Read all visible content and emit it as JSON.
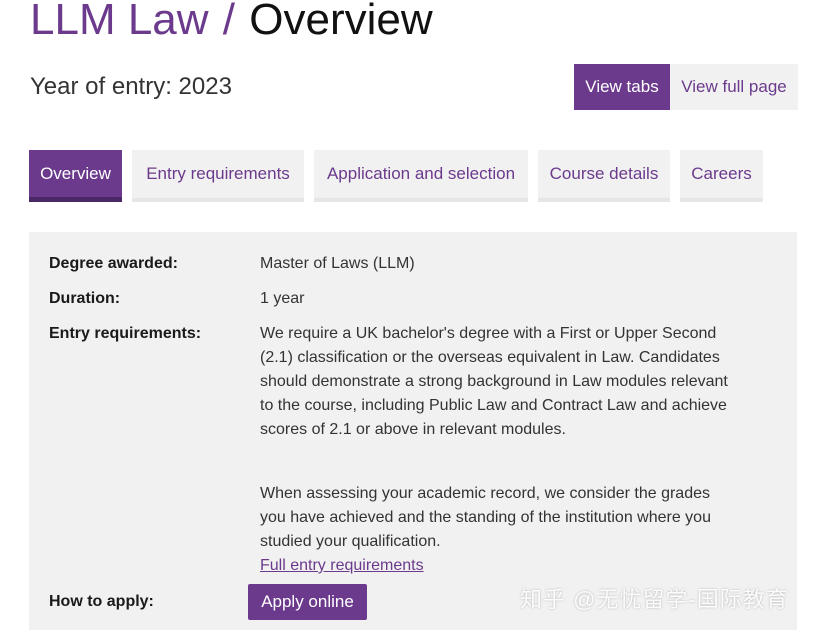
{
  "header": {
    "course": "LLM Law",
    "separator": "/",
    "current_page": "Overview",
    "year_of_entry": "Year of entry: 2023"
  },
  "view_toggle": {
    "tabs_label": "View tabs",
    "full_page_label": "View full page"
  },
  "tabs": [
    {
      "label": "Overview",
      "active": true
    },
    {
      "label": "Entry requirements",
      "active": false
    },
    {
      "label": "Application and selection",
      "active": false
    },
    {
      "label": "Course details",
      "active": false
    },
    {
      "label": "Careers",
      "active": false
    }
  ],
  "overview": {
    "degree_label": "Degree awarded:",
    "degree_value": "Master of Laws (LLM)",
    "duration_label": "Duration:",
    "duration_value": "1 year",
    "entry_label": "Entry requirements:",
    "entry_para1": "We require a UK bachelor's degree with a First or Upper Second (2.1) classification or the overseas equivalent in Law. Candidates should demonstrate a strong background in Law modules relevant to the course, including Public Law and Contract Law and achieve scores of 2.1 or above in relevant modules.",
    "entry_para2": "When assessing your academic record, we consider the grades you have achieved and the standing of the institution where you studied your qualification.",
    "full_entry_link": "Full entry requirements",
    "apply_label": "How to apply:",
    "apply_button": "Apply online"
  },
  "watermark": "知乎 @无忧留学-国际教育",
  "colors": {
    "brand_purple": "#6b3a8c",
    "panel_background": "#f1f1f1",
    "tab_background": "#f1f1f1"
  }
}
